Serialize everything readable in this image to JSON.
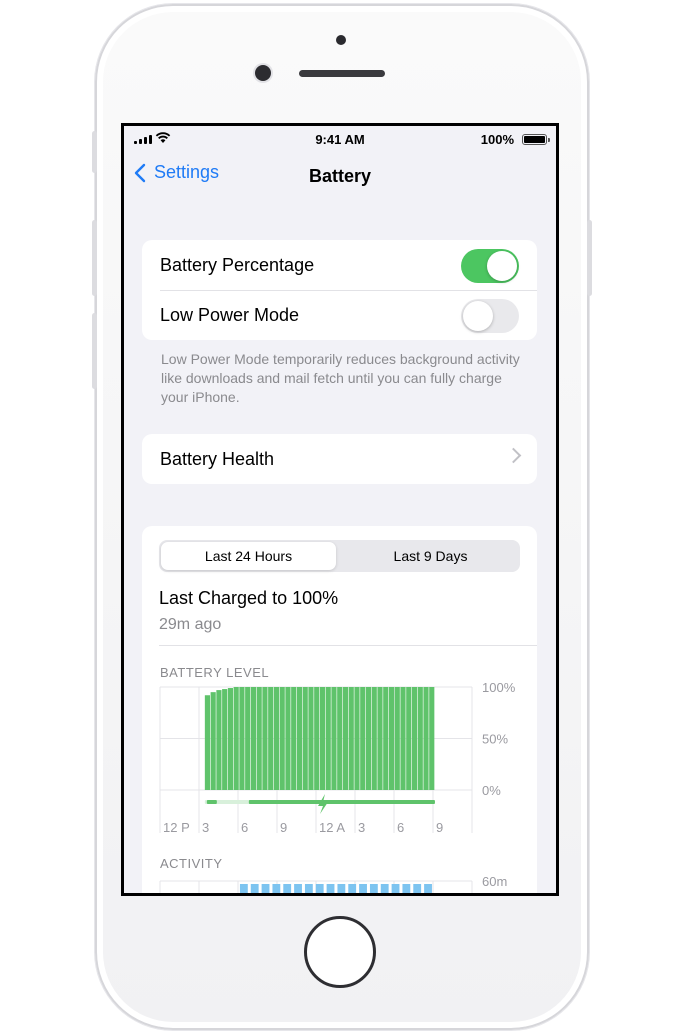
{
  "status_bar": {
    "time": "9:41 AM",
    "battery_percent": "100%"
  },
  "nav": {
    "back_label": "Settings",
    "title": "Battery"
  },
  "settings": {
    "battery_percentage": {
      "label": "Battery Percentage",
      "on": true
    },
    "low_power_mode": {
      "label": "Low Power Mode",
      "on": false
    },
    "footnote": "Low Power Mode temporarily reduces background activity like downloads and mail fetch until you can fully charge your iPhone."
  },
  "battery_health": {
    "label": "Battery Health"
  },
  "usage": {
    "segments": [
      "Last 24 Hours",
      "Last 9 Days"
    ],
    "selected_segment": "Last 24 Hours",
    "last_charged": "Last Charged to 100%",
    "last_charged_ago": "29m ago",
    "battery_level_label": "BATTERY LEVEL",
    "activity_label": "ACTIVITY"
  },
  "colors": {
    "accent": "#1f7bf6",
    "toggle_on": "#4cc661",
    "battery_bar": "#5fc36b",
    "activity_bar": "#7dc4f0"
  },
  "chart_data": [
    {
      "type": "bar",
      "title": "BATTERY LEVEL",
      "x_tick_labels": [
        "12 P",
        "3",
        "6",
        "9",
        "12 A",
        "3",
        "6",
        "9"
      ],
      "y_tick_labels": [
        "100%",
        "50%",
        "0%"
      ],
      "ylim": [
        0,
        100
      ],
      "values": [
        92,
        95,
        97,
        98,
        99,
        100,
        100,
        100,
        100,
        100,
        100,
        100,
        100,
        100,
        100,
        100,
        100,
        100,
        100,
        100,
        100,
        100,
        100,
        100,
        100,
        100,
        100,
        100,
        100,
        100,
        100,
        100,
        100,
        100,
        100,
        100,
        100,
        100,
        100,
        100
      ],
      "charging_indicator": "bolt"
    },
    {
      "type": "bar",
      "title": "ACTIVITY",
      "y_tick_labels": [
        "60m"
      ],
      "values": [
        60,
        60,
        60,
        60,
        60,
        60,
        60,
        60,
        60,
        60,
        60,
        60,
        60,
        60,
        60,
        60,
        60,
        60
      ]
    }
  ]
}
